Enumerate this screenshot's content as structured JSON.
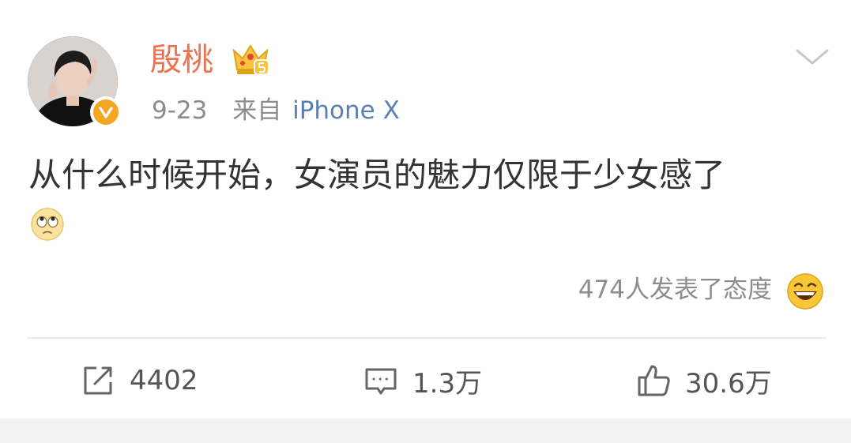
{
  "post": {
    "author": "殷桃",
    "date": "9-23",
    "from_label": "来自",
    "source": "iPhone X",
    "text": "从什么时候开始，女演员的魅力仅限于少女感了",
    "emoji_inline": "rolling-eyes-emoji",
    "reactions_text": "474人发表了态度",
    "reaction_emoji": "grinning-emoji"
  },
  "actions": {
    "repost_count": "4402",
    "comment_count": "1.3万",
    "like_count": "30.6万"
  },
  "colors": {
    "username": "#eb7350",
    "source_link": "#5a7fb3",
    "verified_badge": "#f5a623",
    "meta_gray": "#8c8c8c"
  }
}
